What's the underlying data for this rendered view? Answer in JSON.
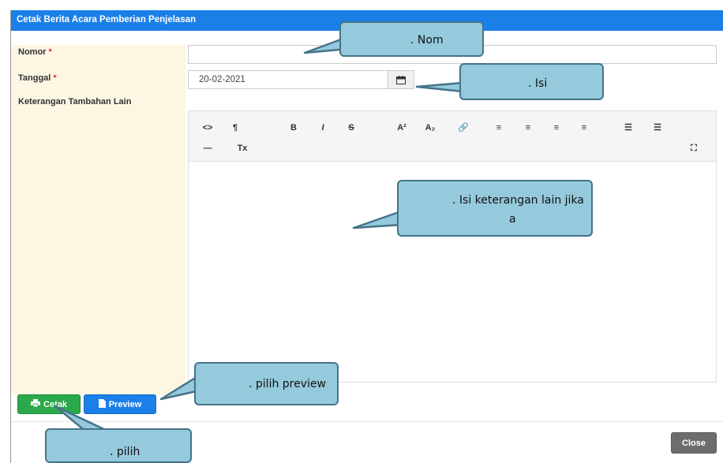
{
  "modal": {
    "title": "Cetak Berita Acara Pemberian Penjelasan"
  },
  "form": {
    "nomor_label": "Nomor",
    "nomor_value": "",
    "tanggal_label": "Tanggal",
    "tanggal_value": "20-02-2021",
    "keterangan_label": "Keterangan Tambahan Lain",
    "required_mark": "*"
  },
  "editor": {
    "toolbar_row1": [
      {
        "name": "source-code-icon",
        "glyph": "<>"
      },
      {
        "name": "paragraph-format-icon",
        "glyph": "¶"
      },
      {
        "name": "bold-icon",
        "glyph": "B"
      },
      {
        "name": "italic-icon",
        "glyph": "I"
      },
      {
        "name": "strikethrough-icon",
        "glyph": "S"
      },
      {
        "name": "superscript-icon",
        "glyph": "A²"
      },
      {
        "name": "subscript-icon",
        "glyph": "A₂"
      },
      {
        "name": "link-icon",
        "glyph": "🔗"
      },
      {
        "name": "align-left-icon",
        "glyph": "≡"
      },
      {
        "name": "align-center-icon",
        "glyph": "≡"
      },
      {
        "name": "align-right-icon",
        "glyph": "≡"
      },
      {
        "name": "align-justify-icon",
        "glyph": "≡"
      },
      {
        "name": "unordered-list-icon",
        "glyph": "☰"
      },
      {
        "name": "ordered-list-icon",
        "glyph": "☰"
      }
    ],
    "toolbar_row2": [
      {
        "name": "horizontal-rule-icon",
        "glyph": "—"
      },
      {
        "name": "clear-format-icon",
        "glyph": "Tx"
      }
    ],
    "fullscreen_icon": "⛶"
  },
  "buttons": {
    "cetak": "Cetak",
    "preview": "Preview",
    "close": "Close"
  },
  "callouts": {
    "nomor": ". Nom",
    "tanggal": ". Isi",
    "keterangan_line1": ". Isi keterangan lain jika",
    "keterangan_line2": "a",
    "preview": ". pilih preview",
    "cetak": ". pilih"
  },
  "colors": {
    "header": "#1b7fe8",
    "label_bg": "#fdf6e3",
    "cetak": "#2aa84a",
    "preview": "#1b7fe8",
    "close": "#6d6d6d",
    "callout_fill": "#95c9dc",
    "callout_border": "#45738a"
  }
}
